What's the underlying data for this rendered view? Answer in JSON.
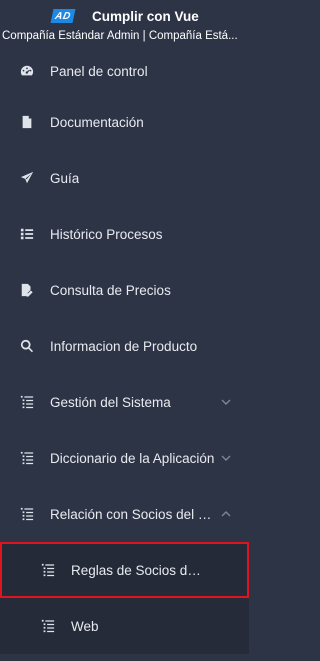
{
  "header": {
    "logo_text": "AD",
    "app_title": "Cumplir con Vue",
    "org_line": "Compañía Estándar Admin | Compañía Está..."
  },
  "menu": {
    "items": [
      {
        "label": "Panel de control",
        "icon": "dashboard-icon"
      },
      {
        "label": "Documentación",
        "icon": "document-icon"
      },
      {
        "label": "Guía",
        "icon": "paper-plane-icon"
      },
      {
        "label": "Histórico Procesos",
        "icon": "list-icon"
      },
      {
        "label": "Consulta de Precios",
        "icon": "price-document-icon"
      },
      {
        "label": "Informacion de Producto",
        "icon": "search-icon"
      },
      {
        "label": "Gestión del Sistema",
        "icon": "tree-list-icon",
        "expand": "chevron-down-icon"
      },
      {
        "label": "Diccionario de la Aplicación",
        "icon": "tree-list-icon",
        "expand": "chevron-down-icon"
      },
      {
        "label": "Relación con Socios del Negocio",
        "icon": "tree-list-icon",
        "expand": "chevron-up-icon"
      }
    ],
    "subitems": [
      {
        "label": "Reglas de Socios del Negocio",
        "icon": "tree-list-icon",
        "selected": true
      },
      {
        "label": "Web",
        "icon": "tree-list-icon"
      }
    ]
  }
}
